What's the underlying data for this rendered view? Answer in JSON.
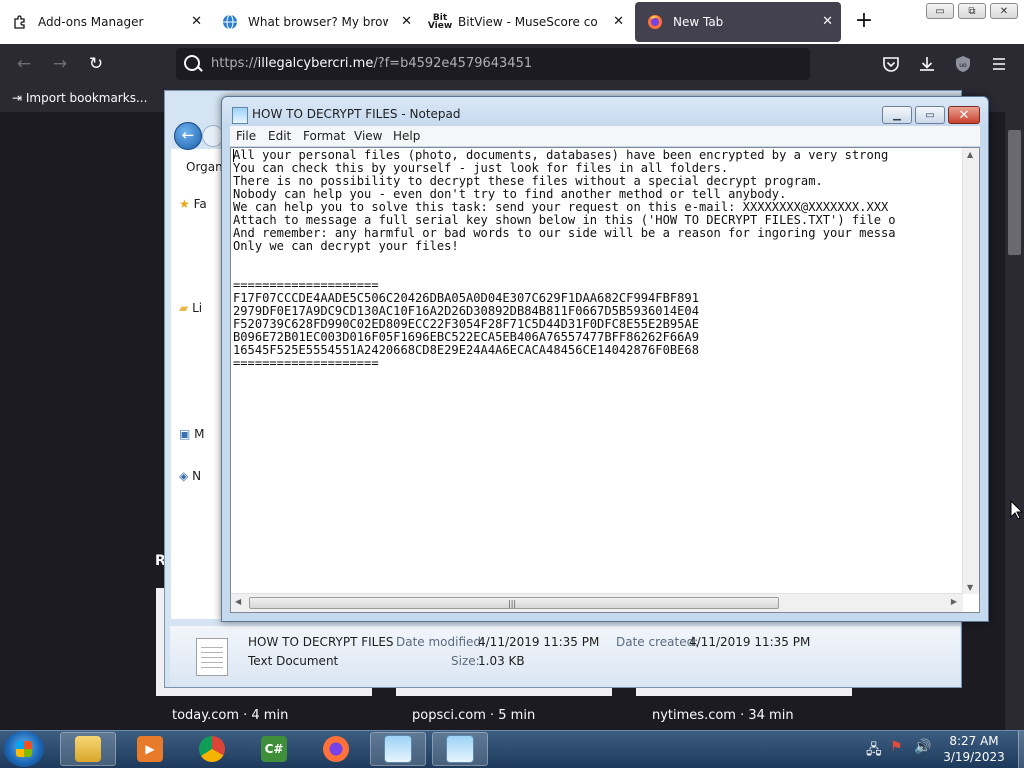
{
  "browser": {
    "tabs": [
      {
        "label": "Add-ons Manager",
        "icon": "puzzle-icon"
      },
      {
        "label": "What browser? My browser? I",
        "icon": "globe-icon"
      },
      {
        "label": "BitView - MuseScore comple",
        "icon": "bitview-icon"
      },
      {
        "label": "New Tab",
        "icon": "firefox-icon",
        "active": true
      }
    ],
    "new_tab_symbol": "+",
    "window_controls": [
      "▭",
      "⧉",
      "✕"
    ],
    "url_prefix": "https://",
    "url_host": "illegalcybercri.me",
    "url_rest": "/?f=b4592e4579643451",
    "bookmark_label": "Import bookmarks...",
    "tile_captions": [
      "today.com · 4 min",
      "popsci.com · 5 min",
      "nytimes.com · 34 min"
    ],
    "section_initial": "R"
  },
  "explorer": {
    "toolbar_label": "Organ",
    "sidebar_fragments": [
      "Fa",
      "Li",
      "M",
      "N"
    ],
    "details": {
      "filename": "HOW TO DECRYPT FILES",
      "type": "Text Document",
      "modified_label": "Date modified:",
      "modified_value": "4/11/2019 11:35 PM",
      "created_label": "Date created:",
      "created_value": "4/11/2019 11:35 PM",
      "size_label": "Size:",
      "size_value": "1.03 KB"
    }
  },
  "notepad": {
    "title": "HOW TO DECRYPT FILES - Notepad",
    "menu": [
      "File",
      "Edit",
      "Format",
      "View",
      "Help"
    ],
    "lines": [
      "All your personal files (photo, documents, databases) have been encrypted by a very strong",
      "You can check this by yourself - just look for files in all folders.",
      "There is no possibility to decrypt these files without a special decrypt program.",
      "Nobody can help you - even don't try to find another method or tell anybody.",
      "We can help you to solve this task: send your request on this e-mail: XXXXXXXX@XXXXXXX.XXX",
      "Attach to message a full serial key shown below in this ('HOW TO DECRYPT FILES.TXT') file o",
      "And remember: any harmful or bad words to our side will be a reason for ingoring your messa",
      "Only we can decrypt your files!",
      "",
      "",
      "====================",
      "F17F07CCCDE4AADE5C506C20426DBA05A0D04E307C629F1DAA682CF994FBF891",
      "2979DF0E17A9DC9CD130AC10F16A2D26D30892DB84B811F0667D5B5936014E04",
      "F520739C628FD990C02ED809ECC22F3054F28F71C5D44D31F0DFC8E55E2B95AE",
      "B096E72B01EC003D016F05F1696EBC522ECA5EB406A76557477BFF86262F66A9",
      "16545F525E5554551A2420668CD8E29E24A4A6ECACA48456CE14042876F0BE68",
      "===================="
    ]
  },
  "taskbar": {
    "time": "8:27 AM",
    "date": "3/19/2023"
  },
  "colors": {
    "firefox_dark": "#1c1b22",
    "firefox_toolbar": "#2b2a33",
    "taskbar": "#1d3a5c",
    "notepad_frame": "#c5d9ef"
  }
}
